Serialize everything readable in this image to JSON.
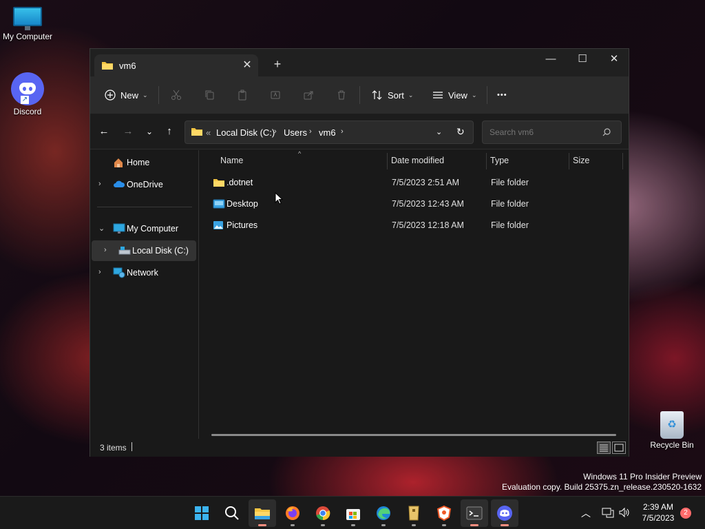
{
  "desktop": {
    "icons": {
      "my_computer": "My Computer",
      "discord": "Discord",
      "recycle_bin": "Recycle Bin"
    },
    "watermark": {
      "line1": "Windows 11 Pro Insider Preview",
      "line2": "Evaluation copy. Build 25375.zn_release.230520-1632"
    }
  },
  "explorer": {
    "tab_title": "vm6",
    "tab_close": "✕",
    "new_tab": "+",
    "window_controls": {
      "minimize": "—",
      "maximize": "☐",
      "close": "✕"
    },
    "toolbar": {
      "new_label": "New",
      "sort_label": "Sort",
      "view_label": "View",
      "more_label": "•••"
    },
    "address": {
      "overflow": "«",
      "segments": [
        "Local Disk (C:)",
        "Users",
        "vm6"
      ],
      "search_placeholder": "Search vm6"
    },
    "nav_pane": {
      "home": "Home",
      "onedrive": "OneDrive",
      "my_computer": "My Computer",
      "local_disk": "Local Disk (C:)",
      "network": "Network"
    },
    "columns": [
      "Name",
      "Date modified",
      "Type",
      "Size"
    ],
    "rows": [
      {
        "name": ".dotnet",
        "date": "7/5/2023 2:51 AM",
        "type": "File folder",
        "icon": "folder-icon"
      },
      {
        "name": "Desktop",
        "date": "7/5/2023 12:43 AM",
        "type": "File folder",
        "icon": "desktop-folder-icon"
      },
      {
        "name": "Pictures",
        "date": "7/5/2023 12:18 AM",
        "type": "File folder",
        "icon": "pictures-folder-icon"
      }
    ],
    "status": "3 items"
  },
  "taskbar": {
    "apps": [
      "start-icon",
      "search-icon",
      "file-explorer-icon",
      "firefox-icon",
      "chrome-icon",
      "store-icon",
      "edge-icon",
      "winrar-icon",
      "brave-icon",
      "terminal-icon",
      "discord-icon"
    ],
    "time": "2:39 AM",
    "date": "7/5/2023",
    "notification_count": "2"
  },
  "colors": {
    "accent": "#4cc2ff",
    "folder": "#f4c542",
    "discord": "#5865f2"
  }
}
